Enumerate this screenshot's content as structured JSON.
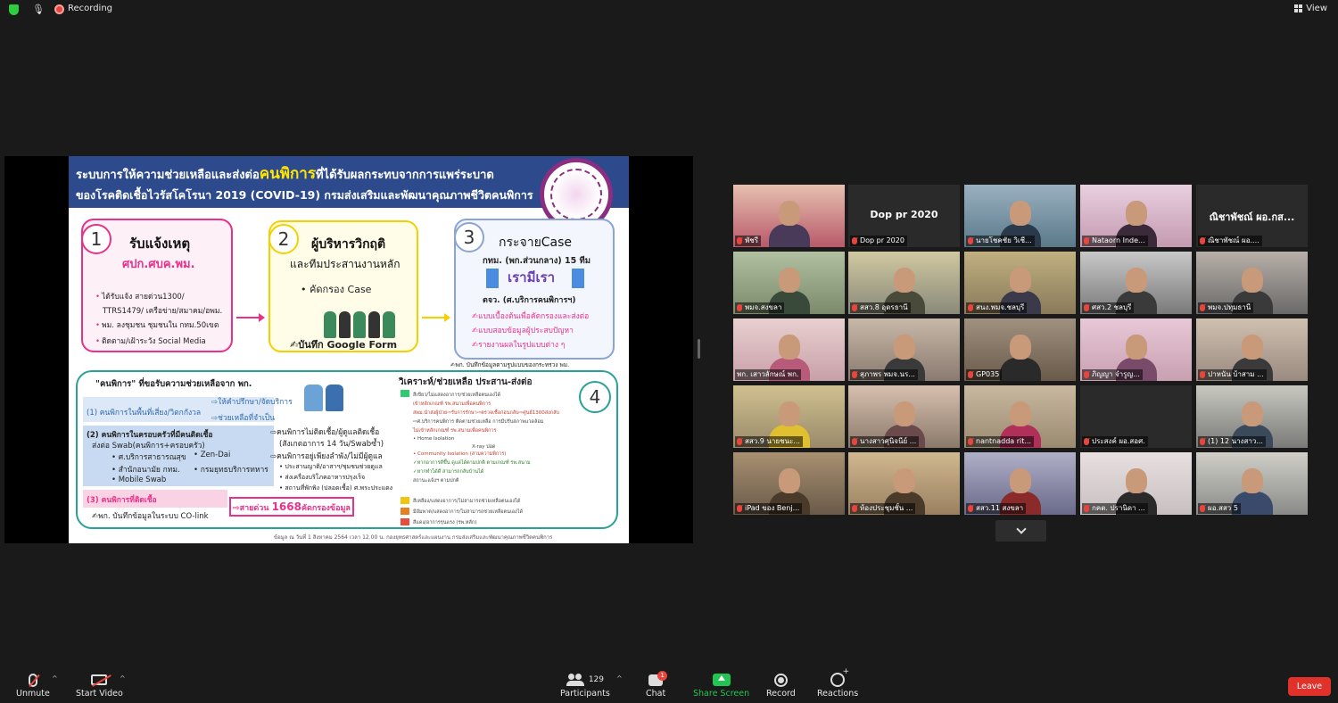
{
  "topbar": {
    "recording_label": "Recording",
    "view_label": "View",
    "icons": [
      "shield-icon",
      "mic-icon",
      "recording-icon",
      "grid-view-icon"
    ]
  },
  "slide": {
    "title_line1_pre": "ระบบการให้ความช่วยเหลือและส่งต่อ",
    "title_line1_em": "คนพิการ",
    "title_line1_post": "ที่ได้รับผลกระทบจากการแพร่ระบาด",
    "title_line2": "ของโรคติดเชื้อไวรัสโคโรนา 2019 (COVID-19)  กรมส่งเสริมและพัฒนาคุณภาพชีวิตคนพิการ",
    "step1": {
      "num": "1",
      "title": "รับแจ้งเหตุ",
      "sub": "ศปก.ศบค.พม.",
      "lines": [
        "ได้รับแจ้ง สายด่วน1300/",
        "TTRS1479/ เครือข่าย/สมาคม/อพม.",
        "พม. ลงชุมชน ชุมชนใน กทม.50เขต",
        "ติดตาม/เฝ้าระวัง Social Media"
      ]
    },
    "step2": {
      "num": "2",
      "title": "ผู้บริหารวิกฤติ",
      "title2": "และทีมประสานงานหลัก",
      "bullet": "•  คัดกรอง Case",
      "form": "✍บันทึก Google Form"
    },
    "step3": {
      "num": "3",
      "title": "กระจายCase",
      "line1": "กทม. (พก.ส่วนกลาง) 15 ทีม",
      "logo": "เรามีเรา",
      "line2": "ตจว. (ศ.บริการคนพิการฯ)",
      "items": [
        "✍แบบเบื้องต้นเพื่อคัดกรองและส่งต่อ",
        "✍แบบสอบข้อมูลผู้ประสบปัญหา",
        "✍รายงานผลในรูปแบบต่าง ๆ"
      ],
      "note": "✍พก. บันทึกข้อมูลตามรูปแบบของกระทรวง พม."
    },
    "step4": {
      "num": "4",
      "title": "วิเคราะห์/ช่วยเหลือ ประสาน-ส่งต่อ",
      "header": "\"คนพิการ\" ที่ขอรับความช่วยเหลือจาก พก.",
      "group1": "(1) คนพิการในพื้นที่เสี่ยง/วิตกกังวล",
      "group1_right": [
        "⇨ให้คำปรึกษา/จัดบริการ",
        "⇨ช่วยเหลือที่จำเป็น"
      ],
      "group2": "(2) คนพิการในครอบครัวที่มีคนติดเชื้อ",
      "group2_sub": "ส่งต่อ Swab(คนพิการ+ครอบครัว)",
      "group2_items": [
        "•  ศ.บริการสาธารณสุข",
        "•  สำนักอนามัย กทม.",
        "•  Mobile Swab",
        "•  Zen-Dai",
        "•  กรมยุทธบริการทหาร"
      ],
      "group2_right": [
        "⇨คนพิการไม่ติดเชื้อ/ผู้ดูแลติดเชื้อ",
        "(สังเกตอาการ 14 วัน/Swabซ้ำ)",
        "⇨คนพิการอยู่เพียงลำพัง/ไม่มีผู้ดูแล",
        "•  ประสานญาติ/อาสาฯ/ชุมชนช่วยดูแล",
        "•  ส่งเครื่องบริโภคอาหารปรุงเร็จ",
        "•  สถานที่พักพิง (ปลอดเชื้อ) ศ.พระประแดง"
      ],
      "group3": "(3) คนพิการที่ติดเชื้อ",
      "group3_note": "✍พก. บันทึกข้อมูลในระบบ CO-link",
      "hotline_pre": "⇨สายด่วน ",
      "hotline_num": "1668",
      "hotline_post": "คัดกรองข้อมูล",
      "mini_lines": [
        "สีเขียว/ไม่แสดงอาการ/ช่วยเหลือตนเองได้",
        "เข้าหลักเกณฑ์ รพ.สนามเพื่อคนพิการ",
        "สพม.นำส่งผู้ป่วย⇨รับการรักษา⇨ตรวจเชื้อก่อนกลับ⇨ศูนย์1300ส่งกลับ",
        "⇨ศ.บริการคนพิการ ติดตามช่วยเหลือ การมีปรับสภาพแวดล้อม",
        "ไม่เข้าหลักเกณฑ์ รพ.สนามเพื่อคนพิการ",
        "•  Home Isolation",
        "X-ray ปอด",
        "•  Community Isolation (สามความพิการ)",
        "✓หากอาการดีขึ้น ดูแลได้ตามปกติ ตามเกณฑ์ รพ.สนาม",
        "✓หากทำได้ดี สามารถกลับบ้านได้",
        "สถานะแจ้งฯ ตามปกติ",
        "สีเหลือง/แสดงอาการ/ไม่สามารถช่วยเหลือตนเองได้",
        "มีอัมพาต/แสดงอาการ/ไม่สามารถช่วยเหลือตนเองได้",
        "สีแดง/อาการรุนแรง (รพ.หลัก)"
      ]
    },
    "footnote": "ข้อมูล ณ วันที่ 1 สิงหาคม 2564 เวลา 12.00 น. กองยุทธศาสตร์และแผนงาน กรมส่งเสริมและพัฒนาคุณภาพชีวิตคนพิการ"
  },
  "participants_grid": [
    {
      "label": "พัชรี",
      "muted": true,
      "type": "video"
    },
    {
      "label": "Dop pr 2020",
      "muted": true,
      "type": "name",
      "big_name": "Dop pr 2020"
    },
    {
      "label": "นายโชคชัย วิเชี...",
      "muted": true,
      "type": "video"
    },
    {
      "label": "Nataorn Inde...",
      "muted": true,
      "type": "video"
    },
    {
      "label": "ณิชาพัชณ์ ผอ....",
      "muted": true,
      "type": "name",
      "big_name": "ณิชาพัชณ์ ผอ.กส..."
    },
    {
      "label": "พมจ.สงขลา",
      "muted": true,
      "type": "video"
    },
    {
      "label": "สสว.8 อุดรธานี",
      "muted": true,
      "type": "video"
    },
    {
      "label": "สนง.พมจ.ชลบุรี",
      "muted": true,
      "type": "video"
    },
    {
      "label": "ศสว.2 ชลบุรี",
      "muted": true,
      "type": "video"
    },
    {
      "label": "พมจ.ปทุมธานี",
      "muted": true,
      "type": "video"
    },
    {
      "label": "พก. เสาวลักษณ์ พก.",
      "muted": false,
      "type": "video",
      "active": true
    },
    {
      "label": "สุภาพร พมจ.นร...",
      "muted": true,
      "type": "video"
    },
    {
      "label": "GP035",
      "muted": true,
      "type": "video"
    },
    {
      "label": "ภิญญา จำรูญ...",
      "muted": true,
      "type": "video"
    },
    {
      "label": "ปาหนัน บ้าสาม ...",
      "muted": true,
      "type": "video"
    },
    {
      "label": "สสว.9 นายชนะ...",
      "muted": true,
      "type": "video"
    },
    {
      "label": "นางสาวศุนิจนีย์ ...",
      "muted": true,
      "type": "video"
    },
    {
      "label": "nantnadda rit...",
      "muted": true,
      "type": "video"
    },
    {
      "label": "ประสงค์ ผอ.สอศ.",
      "muted": true,
      "type": "blank"
    },
    {
      "label": "(1) 12 นางสาว...",
      "muted": true,
      "type": "video"
    },
    {
      "label": "iPad ของ Benj...",
      "muted": true,
      "type": "video"
    },
    {
      "label": "ห้องประชุมชั้น ...",
      "muted": true,
      "type": "video"
    },
    {
      "label": "สสว.11 สงขลา",
      "muted": true,
      "type": "video"
    },
    {
      "label": "กคต. ปรานิดา ...",
      "muted": true,
      "type": "video"
    },
    {
      "label": "ผอ.สสว 5",
      "muted": true,
      "type": "video"
    }
  ],
  "toolbar": {
    "unmute": "Unmute",
    "start_video": "Start Video",
    "participants": "Participants",
    "participants_count": "129",
    "chat": "Chat",
    "chat_badge": "1",
    "share_screen": "Share Screen",
    "record": "Record",
    "reactions": "Reactions",
    "leave": "Leave"
  },
  "colors": {
    "background": "#1a1a1a",
    "share_green": "#23c552",
    "leave_red": "#e0312b",
    "active_speaker": "#d4e157",
    "muted_red": "#e8453c",
    "slide_header": "#2d4a8c"
  }
}
